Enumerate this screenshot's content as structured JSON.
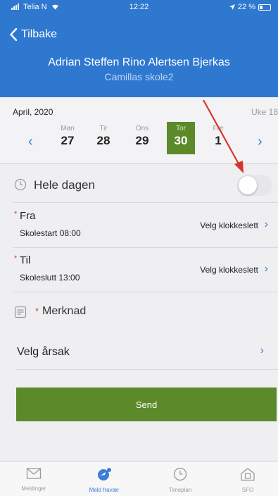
{
  "status": {
    "carrier": "Telia N",
    "time": "12:22",
    "battery": "22 %"
  },
  "header": {
    "back_label": "Tilbake",
    "student_name": "Adrian Steffen Rino Alertsen Bjerkas",
    "school_name": "Camillas skole2",
    "color": "#2f78cf"
  },
  "calendar": {
    "month": "April, 2020",
    "week": "Uke 18",
    "prev_arrow": "‹",
    "next_arrow": "›",
    "days": [
      {
        "name": "Man",
        "date": "27"
      },
      {
        "name": "Tir",
        "date": "28"
      },
      {
        "name": "Ons",
        "date": "29"
      },
      {
        "name": "Tor",
        "date": "30",
        "selected": true
      },
      {
        "name": "Fre",
        "date": "1"
      }
    ]
  },
  "form": {
    "allday_label": "Hele dagen",
    "allday_on": false,
    "from": {
      "required_mark": "*",
      "label": "Fra",
      "default": "Skolestart 08:00",
      "picker": "Velg klokkeslett"
    },
    "to": {
      "required_mark": "*",
      "label": "Til",
      "default": "Skoleslutt 13:00",
      "picker": "Velg klokkeslett"
    },
    "note_required_mark": "*",
    "note_label": "Merknad",
    "reason_label": "Velg årsak",
    "chevron": "›",
    "send_label": "Send"
  },
  "tabs": [
    {
      "label": "Meldinger",
      "icon": "envelope-icon"
    },
    {
      "label": "Meld fravær",
      "icon": "report-absence-icon",
      "active": true
    },
    {
      "label": "Timeplan",
      "icon": "clock-icon"
    },
    {
      "label": "SFO",
      "icon": "home-icon"
    }
  ],
  "colors": {
    "accent": "#3a7fd6",
    "green": "#5c8a2a",
    "required": "#d83a3a",
    "annotation": "#d9342b"
  }
}
